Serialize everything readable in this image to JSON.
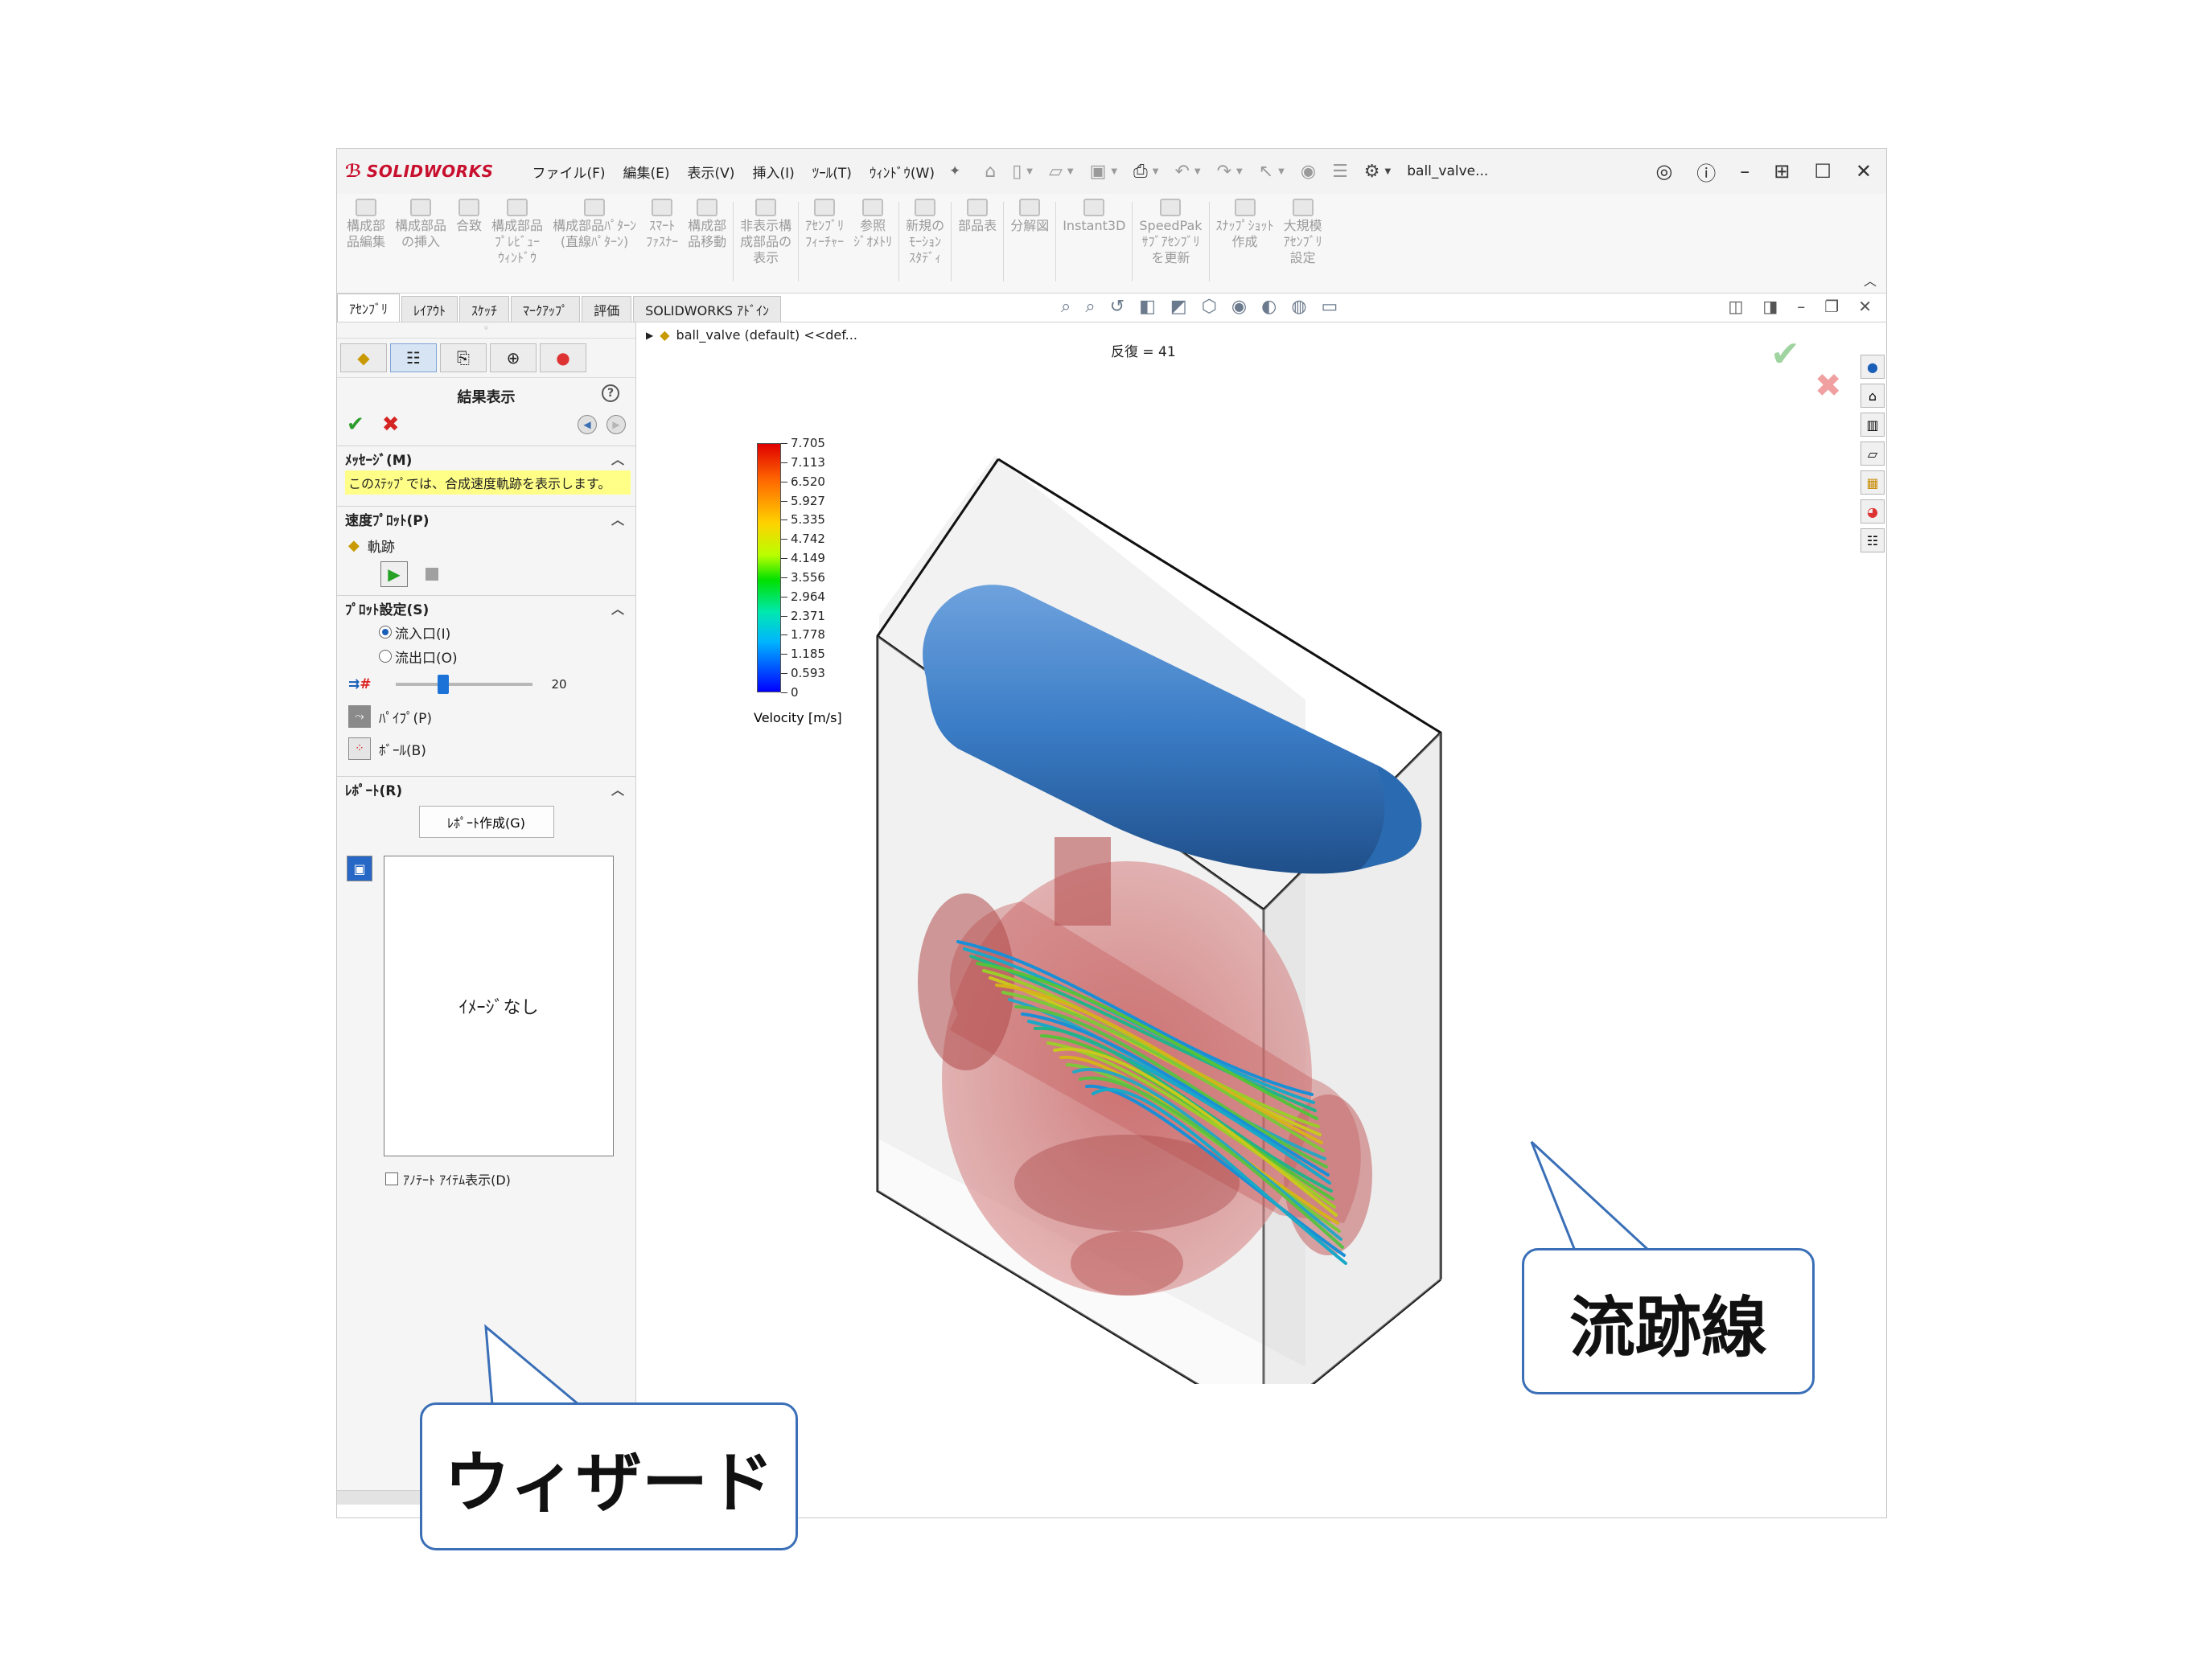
{
  "window": {
    "brand": "SOLIDWORKS",
    "menus": [
      "ファイル(F)",
      "編集(E)",
      "表示(V)",
      "挿入(I)",
      "ﾂｰﾙ(T)",
      "ｳｨﾝﾄﾞｳ(W)"
    ],
    "doc_title": "ball_valve..."
  },
  "command_manager": {
    "commands": [
      "構成部\n品編集",
      "構成部品\nの挿入",
      "合致",
      "構成部品\nﾌﾟﾚﾋﾞｭｰ\nｳｨﾝﾄﾞｳ",
      "構成部品ﾊﾟﾀｰﾝ\n(直線ﾊﾟﾀｰﾝ)",
      "ｽﾏｰﾄ\nﾌｧｽﾅｰ",
      "構成部\n品移動",
      "非表示構\n成部品の\n表示",
      "ｱｾﾝﾌﾞﾘ\nﾌｨｰﾁｬｰ",
      "参照\nｼﾞｵﾒﾄﾘ",
      "新規の\nﾓｰｼｮﾝ\nｽﾀﾃﾞｨ",
      "部品表",
      "分解図",
      "Instant3D",
      "SpeedPak\nｻﾌﾞｱｾﾝﾌﾞﾘ\nを更新",
      "ｽﾅｯﾌﾟｼｮｯﾄ\n作成",
      "大規模\nｱｾﾝﾌﾞﾘ\n設定"
    ]
  },
  "tabs": [
    "ｱｾﾝﾌﾞﾘ",
    "ﾚｲｱｳﾄ",
    "ｽｹｯﾁ",
    "ﾏｰｸｱｯﾌﾟ",
    "評価",
    "SOLIDWORKS ｱﾄﾞｲﾝ"
  ],
  "property_manager": {
    "title": "結果表示",
    "message_header": "ﾒｯｾｰｼﾞ(M)",
    "message": "このｽﾃｯﾌﾟでは、合成速度軌跡を表示します。",
    "velocity_plot_header": "速度ﾌﾟﾛｯﾄ(P)",
    "trajectory_label": "軌跡",
    "plot_settings_header": "ﾌﾟﾛｯﾄ設定(S)",
    "inlet_label": "流入口(I)",
    "outlet_label": "流出口(O)",
    "selected_option": "inlet",
    "count_value": "20",
    "count_fraction": 0.35,
    "pipe_label": "ﾊﾟｲﾌﾟ(P)",
    "ball_label": "ﾎﾞｰﾙ(B)",
    "report_header": "ﾚﾎﾟｰﾄ(R)",
    "report_button": "ﾚﾎﾟｰﾄ作成(G)",
    "no_image": "ｲﾒｰｼﾞなし",
    "annotation_checkbox": "ｱﾉﾃｰﾄ ｱｲﾃﾑ表示(D)"
  },
  "viewport": {
    "tree_label": "ball_valve (default) <<def...",
    "iteration": "反復 = 41",
    "legend": {
      "title": "Velocity [m/s]",
      "ticks": [
        "7.705",
        "7.113",
        "6.520",
        "5.927",
        "5.335",
        "4.742",
        "4.149",
        "3.556",
        "2.964",
        "2.371",
        "1.778",
        "1.185",
        "0.593",
        "0"
      ]
    }
  },
  "callouts": {
    "wizard": "ウィザード",
    "streamline": "流跡線"
  }
}
